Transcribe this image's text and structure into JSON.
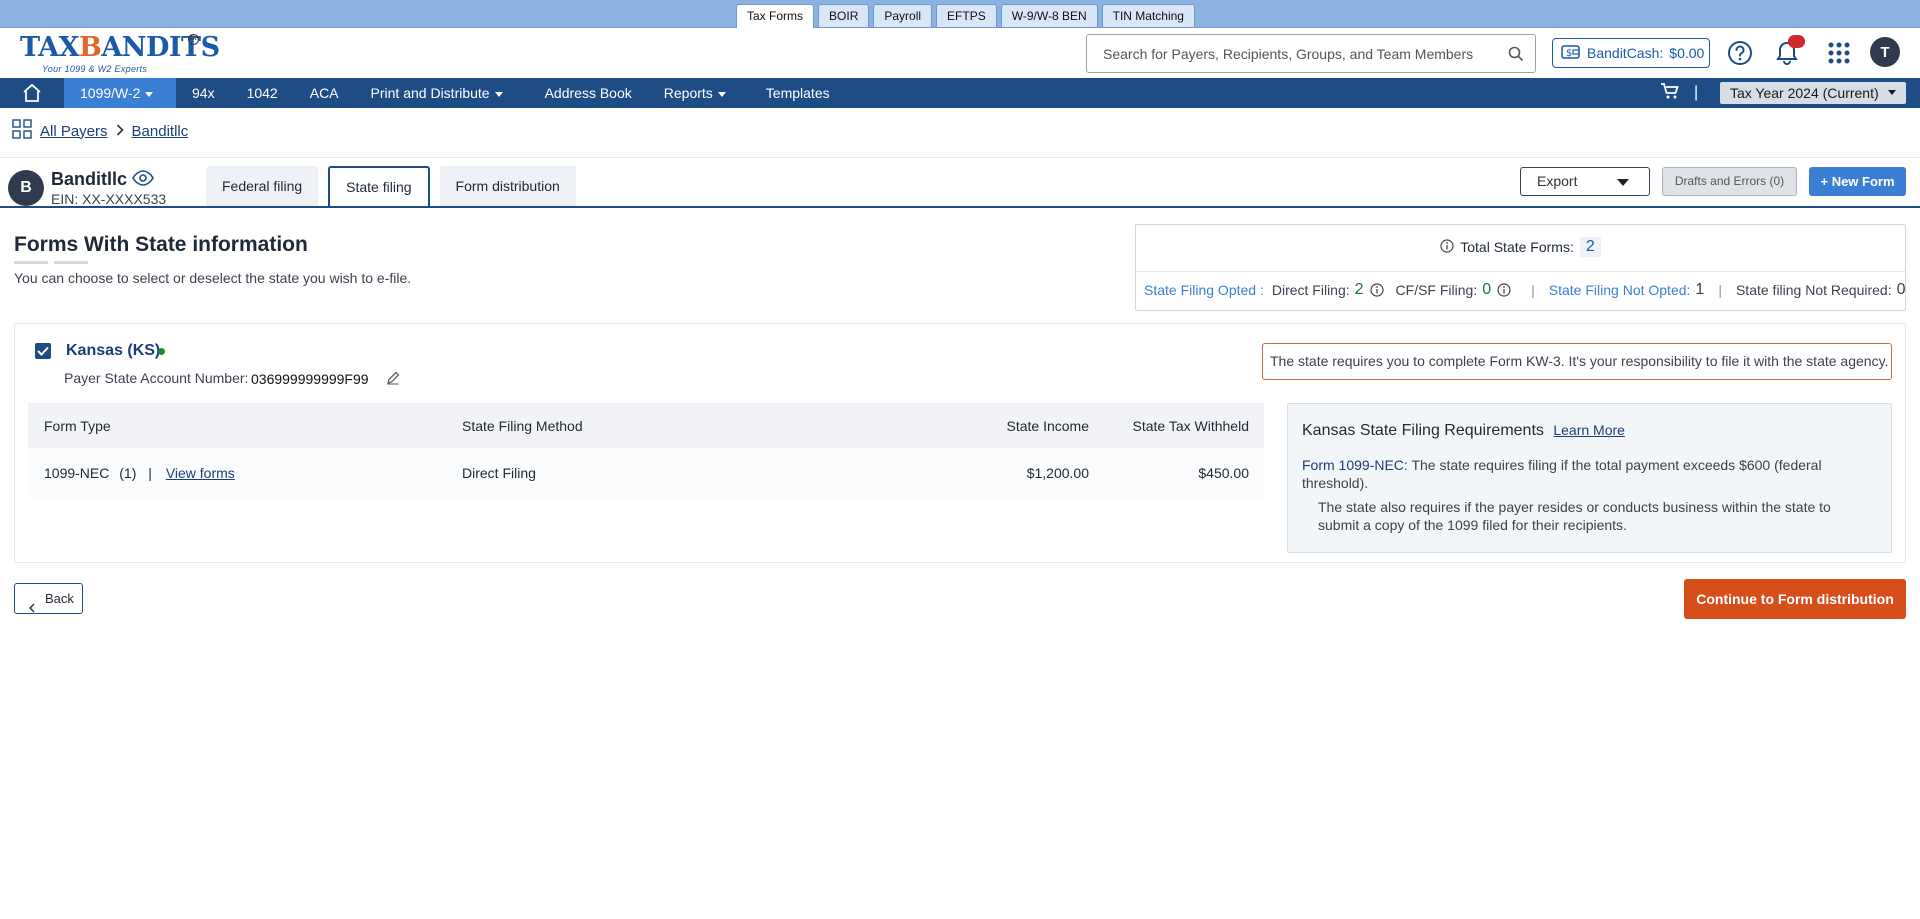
{
  "top_tabs": [
    "Tax Forms",
    "BOIR",
    "Payroll",
    "EFTPS",
    "W-9/W-8 BEN",
    "TIN Matching"
  ],
  "header": {
    "logo_prefix": "TAX",
    "logo_mid": "B",
    "logo_suffix": "ANDITS",
    "logo_tagline": "Your 1099 & W2 Experts",
    "logo_mark": "TM",
    "search_placeholder": "Search for Payers, Recipients, Groups, and Team Members",
    "bandit_cash_label": "BanditCash:",
    "bandit_cash_value": "$0.00",
    "avatar_initial": "T"
  },
  "nav": {
    "items": [
      "1099/W-2",
      "94x",
      "1042",
      "ACA",
      "Print and Distribute",
      "Address Book",
      "Reports",
      "Templates"
    ],
    "cart_separator": "|",
    "tax_year": "Tax Year 2024 (Current)"
  },
  "breadcrumb": {
    "root": "All Payers",
    "current": "Banditllc"
  },
  "payer": {
    "initial": "B",
    "name": "Banditllc",
    "ein": "EIN: XX-XXXX533"
  },
  "subtabs": [
    "Federal filing",
    "State filing",
    "Form distribution"
  ],
  "actions": {
    "export": "Export",
    "drafts": "Drafts and Errors (0)",
    "new_form": "New Form"
  },
  "section": {
    "title": "Forms With State information",
    "subtitle": "You can choose to select or deselect the state you wish to e-file."
  },
  "summary": {
    "total_label": "Total State Forms:",
    "total_value": "2",
    "opted_label": "State Filing Opted :",
    "direct_label": "Direct Filing:",
    "direct_value": "2",
    "cfsf_label": "CF/SF Filing:",
    "cfsf_value": "0",
    "not_opted_label": "State Filing Not Opted:",
    "not_opted_value": "1",
    "not_required_label": "State filing Not Required:",
    "not_required_value": "0",
    "pipe": "|"
  },
  "state": {
    "name": "Kansas (KS)",
    "account_label": "Payer State Account Number:",
    "account_value": "036999999999F99",
    "notice": "The state requires you to complete Form KW-3. It's your responsibility to file it with the state agency.",
    "table": {
      "headers": [
        "Form Type",
        "State Filing Method",
        "State Income",
        "State Tax Withheld"
      ],
      "rows": [
        {
          "form_type": "1099-NEC",
          "count": "(1)",
          "pipe": "|",
          "link": "View forms",
          "method": "Direct Filing",
          "income": "$1,200.00",
          "withheld": "$450.00"
        }
      ]
    },
    "requirements": {
      "title": "Kansas State Filing Requirements",
      "learn_more": "Learn More",
      "form_label": "Form 1099-NEC:",
      "p1": "The state requires filing if the total payment exceeds $600 (federal threshold).",
      "p2": "The state also requires if the payer resides or conducts business within the state to submit a copy of the 1099 filed for their recipients."
    }
  },
  "footer": {
    "back": "Back",
    "continue": "Continue to Form distribution"
  },
  "colors": {
    "nav": "#1e4d86",
    "nav_active": "#3b7fd4",
    "continue": "#d64f1b",
    "top_strip": "#8cb2e0"
  }
}
